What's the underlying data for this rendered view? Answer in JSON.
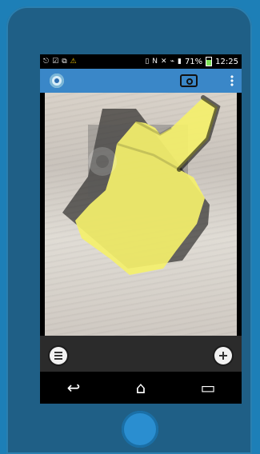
{
  "status_bar": {
    "left_icons": [
      "usb-icon",
      "checkbox-icon",
      "clipboard-icon",
      "warning-icon"
    ],
    "right_icons": [
      "vibrate-icon",
      "nfc-icon",
      "mute-icon",
      "wifi-icon",
      "signal-icon"
    ],
    "battery_percent": "71%",
    "time": "12:25"
  },
  "app_bar": {
    "app_icon": "app-logo-icon",
    "action_icons": [
      "camera-icon",
      "overflow-menu-icon"
    ]
  },
  "controls": {
    "left_button_icon": "list-icon",
    "right_button_icon": "add-icon"
  },
  "nav": {
    "back_glyph": "↩",
    "home_glyph": "⌂",
    "recents_glyph": "▭"
  },
  "colors": {
    "device_body": "#1f5f86",
    "app_bar": "#3a87c8",
    "hand_fill": "#f4f06b"
  }
}
